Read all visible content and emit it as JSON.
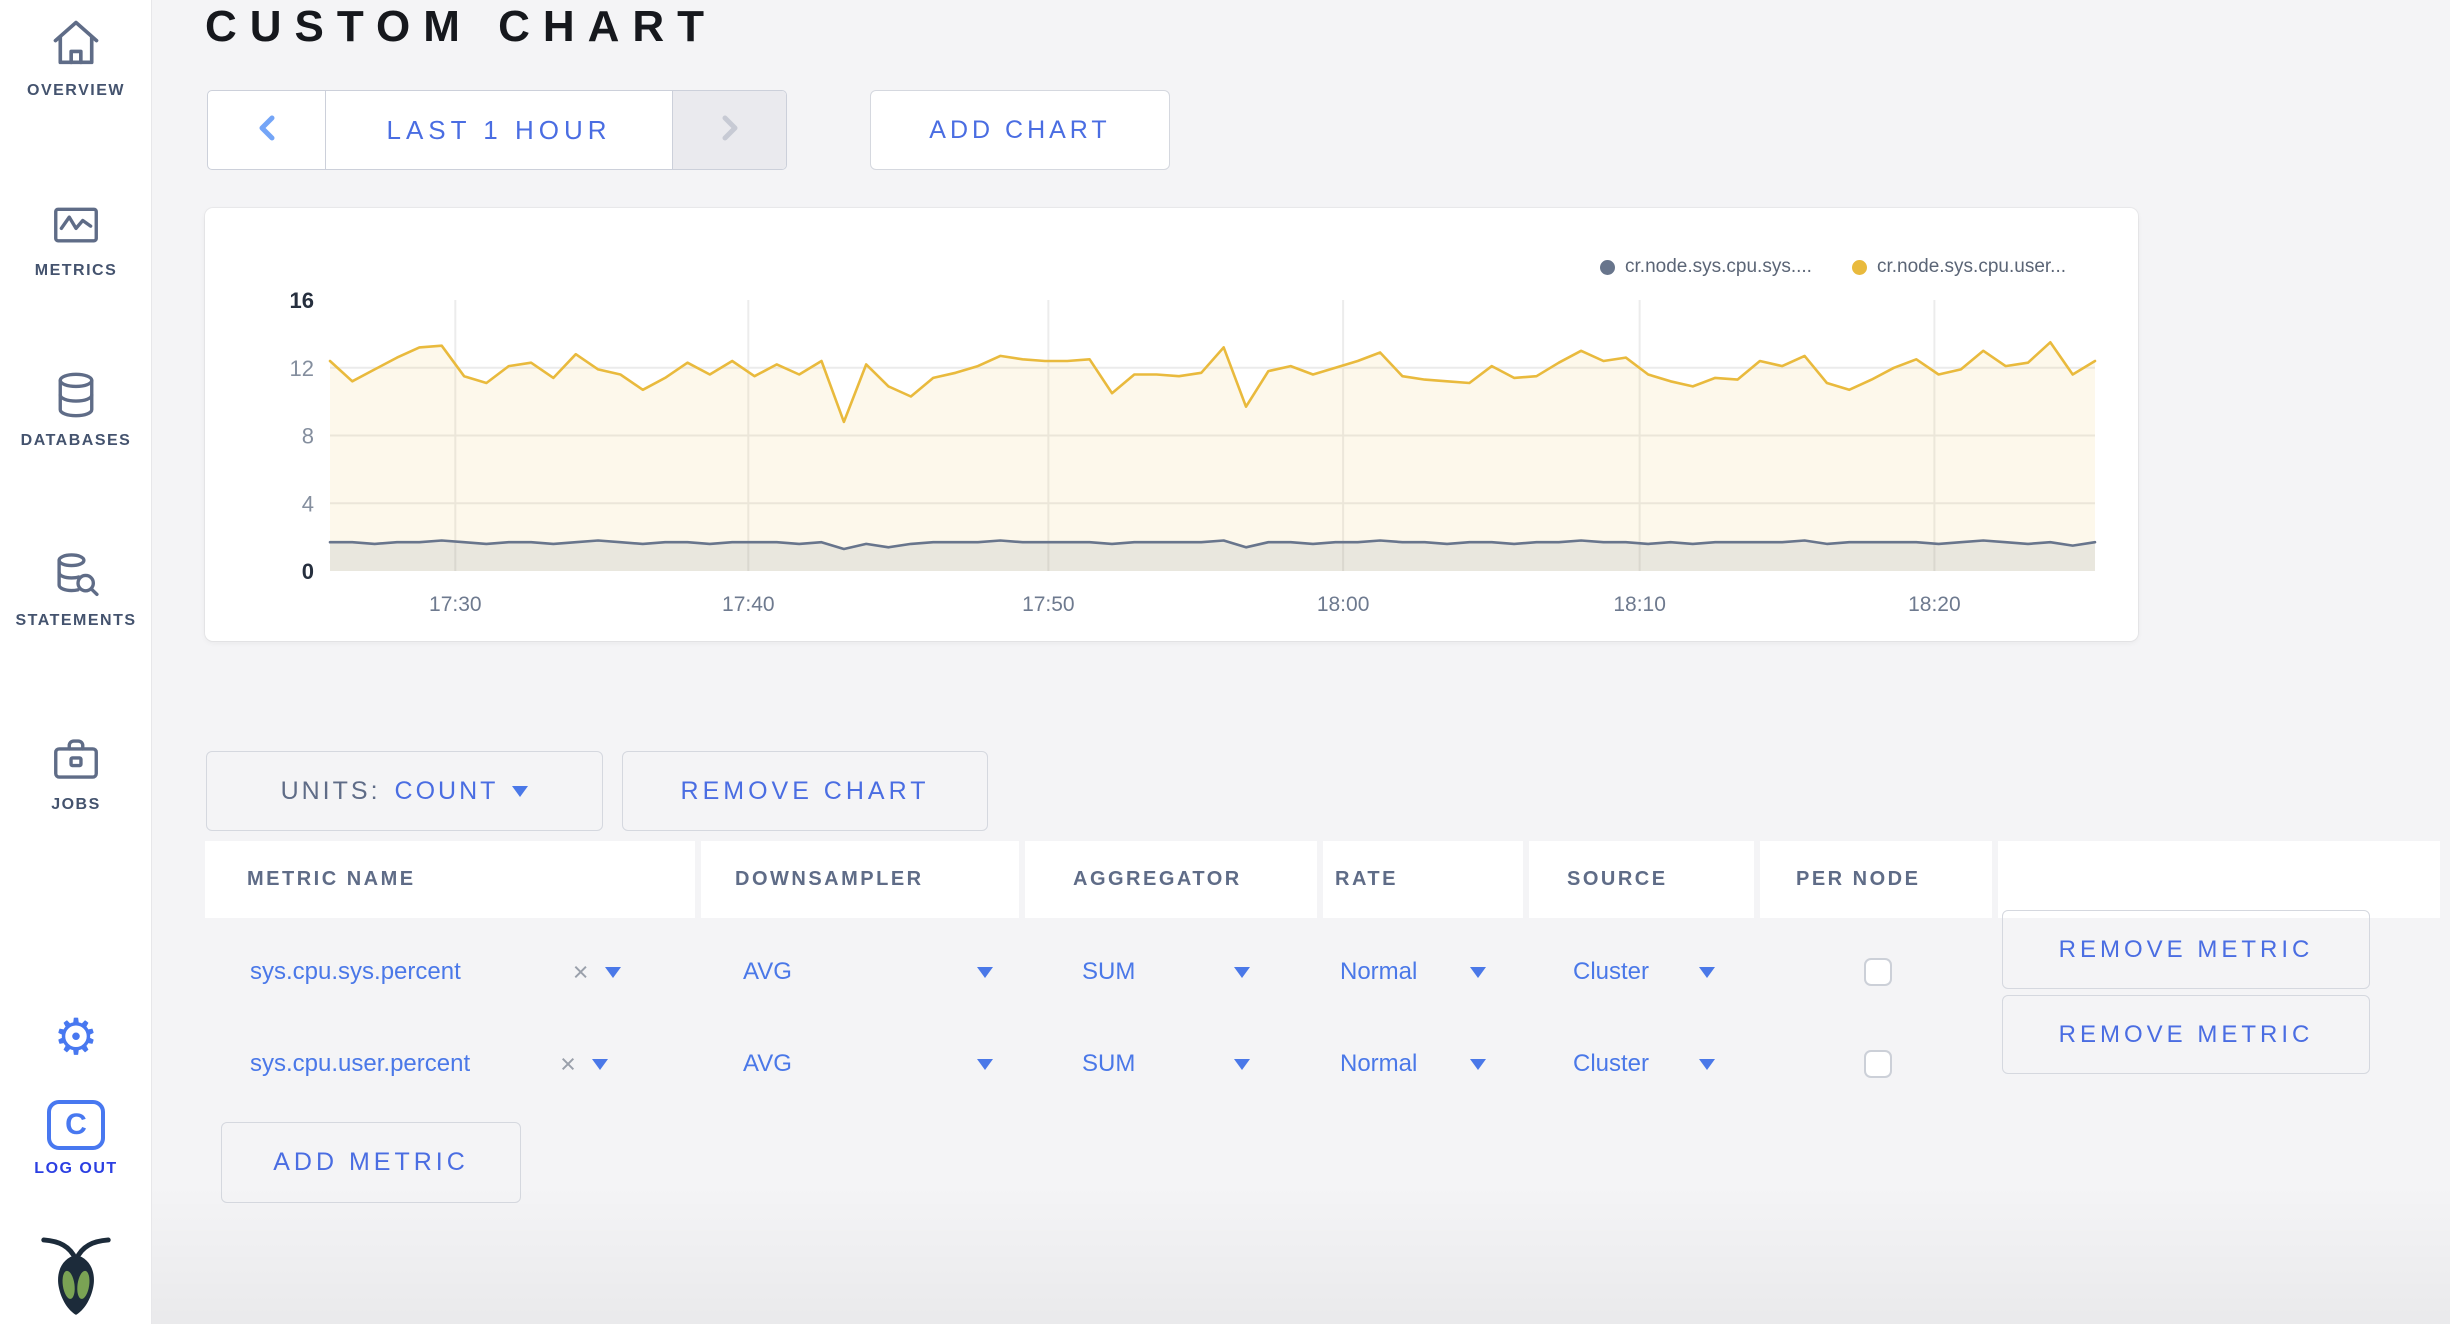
{
  "header": {
    "title": "CUSTOM CHART"
  },
  "time_nav": {
    "range_label": "LAST 1 HOUR"
  },
  "actions": {
    "add_chart": "ADD CHART",
    "remove_chart": "REMOVE CHART",
    "add_metric": "ADD METRIC",
    "remove_metric": "REMOVE METRIC"
  },
  "units": {
    "label": "UNITS:",
    "value": "COUNT"
  },
  "icons": {
    "gear": "⚙",
    "clear": "×",
    "logout_letter": "C"
  },
  "sidebar": {
    "items": [
      {
        "label": "OVERVIEW"
      },
      {
        "label": "METRICS"
      },
      {
        "label": "DATABASES"
      },
      {
        "label": "STATEMENTS"
      },
      {
        "label": "JOBS"
      }
    ],
    "logout_label": "LOG OUT"
  },
  "table": {
    "headers": [
      "METRIC NAME",
      "DOWNSAMPLER",
      "AGGREGATOR",
      "RATE",
      "SOURCE",
      "PER NODE"
    ],
    "rows": [
      {
        "name": "sys.cpu.sys.percent",
        "downsampler": "AVG",
        "aggregator": "SUM",
        "rate": "Normal",
        "source": "Cluster",
        "per_node_checked": false
      },
      {
        "name": "sys.cpu.user.percent",
        "downsampler": "AVG",
        "aggregator": "SUM",
        "rate": "Normal",
        "source": "Cluster",
        "per_node_checked": false
      }
    ]
  },
  "chart_data": {
    "type": "line",
    "title": "",
    "xlabel": "",
    "ylabel": "",
    "ylim": [
      0,
      16
    ],
    "yticks": [
      0,
      4,
      8,
      12,
      16
    ],
    "grid": true,
    "legend_position": "top-right",
    "categories": [
      "17:30",
      "17:40",
      "17:50",
      "18:00",
      "18:10",
      "18:20"
    ],
    "x_fractions": [
      0.071,
      0.237,
      0.407,
      0.574,
      0.742,
      0.909
    ],
    "series": [
      {
        "name": "cr.node.sys.cpu.sys....",
        "color": "#68758C",
        "fill": "rgba(104,117,140,0.13)",
        "values": [
          1.7,
          1.7,
          1.6,
          1.7,
          1.7,
          1.8,
          1.7,
          1.6,
          1.7,
          1.7,
          1.6,
          1.7,
          1.8,
          1.7,
          1.6,
          1.7,
          1.7,
          1.6,
          1.7,
          1.7,
          1.7,
          1.6,
          1.7,
          1.3,
          1.6,
          1.4,
          1.6,
          1.7,
          1.7,
          1.7,
          1.8,
          1.7,
          1.7,
          1.7,
          1.7,
          1.6,
          1.7,
          1.7,
          1.7,
          1.7,
          1.8,
          1.4,
          1.7,
          1.7,
          1.6,
          1.7,
          1.7,
          1.8,
          1.7,
          1.7,
          1.6,
          1.7,
          1.7,
          1.6,
          1.7,
          1.7,
          1.8,
          1.7,
          1.7,
          1.6,
          1.7,
          1.6,
          1.7,
          1.7,
          1.7,
          1.7,
          1.8,
          1.6,
          1.7,
          1.7,
          1.7,
          1.7,
          1.6,
          1.7,
          1.8,
          1.7,
          1.6,
          1.7,
          1.5,
          1.7
        ]
      },
      {
        "name": "cr.node.sys.cpu.user...",
        "color": "#E9BA3D",
        "fill": "rgba(233,186,61,0.10)",
        "values": [
          12.4,
          11.2,
          11.9,
          12.6,
          13.2,
          13.3,
          11.5,
          11.1,
          12.1,
          12.3,
          11.4,
          12.8,
          11.9,
          11.6,
          10.7,
          11.4,
          12.3,
          11.6,
          12.4,
          11.5,
          12.2,
          11.6,
          12.4,
          8.8,
          12.2,
          10.9,
          10.3,
          11.4,
          11.7,
          12.1,
          12.7,
          12.5,
          12.4,
          12.4,
          12.5,
          10.5,
          11.6,
          11.6,
          11.5,
          11.7,
          13.2,
          9.7,
          11.8,
          12.1,
          11.6,
          12.0,
          12.4,
          12.9,
          11.5,
          11.3,
          11.2,
          11.1,
          12.1,
          11.4,
          11.5,
          12.3,
          13.0,
          12.4,
          12.6,
          11.6,
          11.2,
          10.9,
          11.4,
          11.3,
          12.4,
          12.1,
          12.7,
          11.1,
          10.7,
          11.3,
          12.0,
          12.5,
          11.6,
          11.9,
          13.0,
          12.1,
          12.3,
          13.5,
          11.6,
          12.4
        ]
      }
    ]
  }
}
